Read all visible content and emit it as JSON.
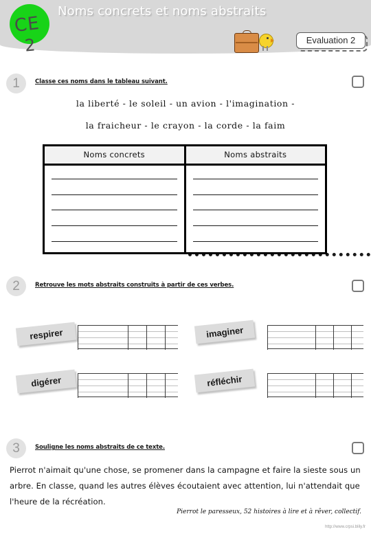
{
  "header": {
    "title": "Noms concrets et noms abstraits",
    "logo_line1": "CE",
    "logo_line2": "2",
    "logo_color": "#18d318",
    "badge_label": "Evaluation 2"
  },
  "exercise1": {
    "number": "1",
    "instruction": "Classe ces noms dans le tableau suivant.",
    "word_line_1": "la liberté - le soleil - un avion - l'imagination -",
    "word_line_2": "la fraicheur - le crayon - la corde - la faim",
    "table": {
      "headers": [
        "Noms concrets",
        "Noms abstraits"
      ],
      "rows": 5
    }
  },
  "exercise2": {
    "number": "2",
    "instruction": "Retrouve les mots abstraits construits à partir de ces verbes.",
    "verbs": [
      {
        "label": "respirer"
      },
      {
        "label": "imaginer"
      },
      {
        "label": "digérer"
      },
      {
        "label": "réfléchir"
      }
    ]
  },
  "exercise3": {
    "number": "3",
    "instruction": "Souligne les noms abstraits de ce texte.",
    "text": "Pierrot n'aimait qu'une chose, se promener dans la campagne et faire la sieste sous un arbre. En classe, quand les autres élèves écoutaient avec attention, lui n'attendait que l'heure de la récréation.",
    "source": "Pierrot le paresseux, 52 histoires à lire et à rêver, collectif."
  },
  "footer": {
    "url": "http://www.crpsi.blily.fr"
  }
}
